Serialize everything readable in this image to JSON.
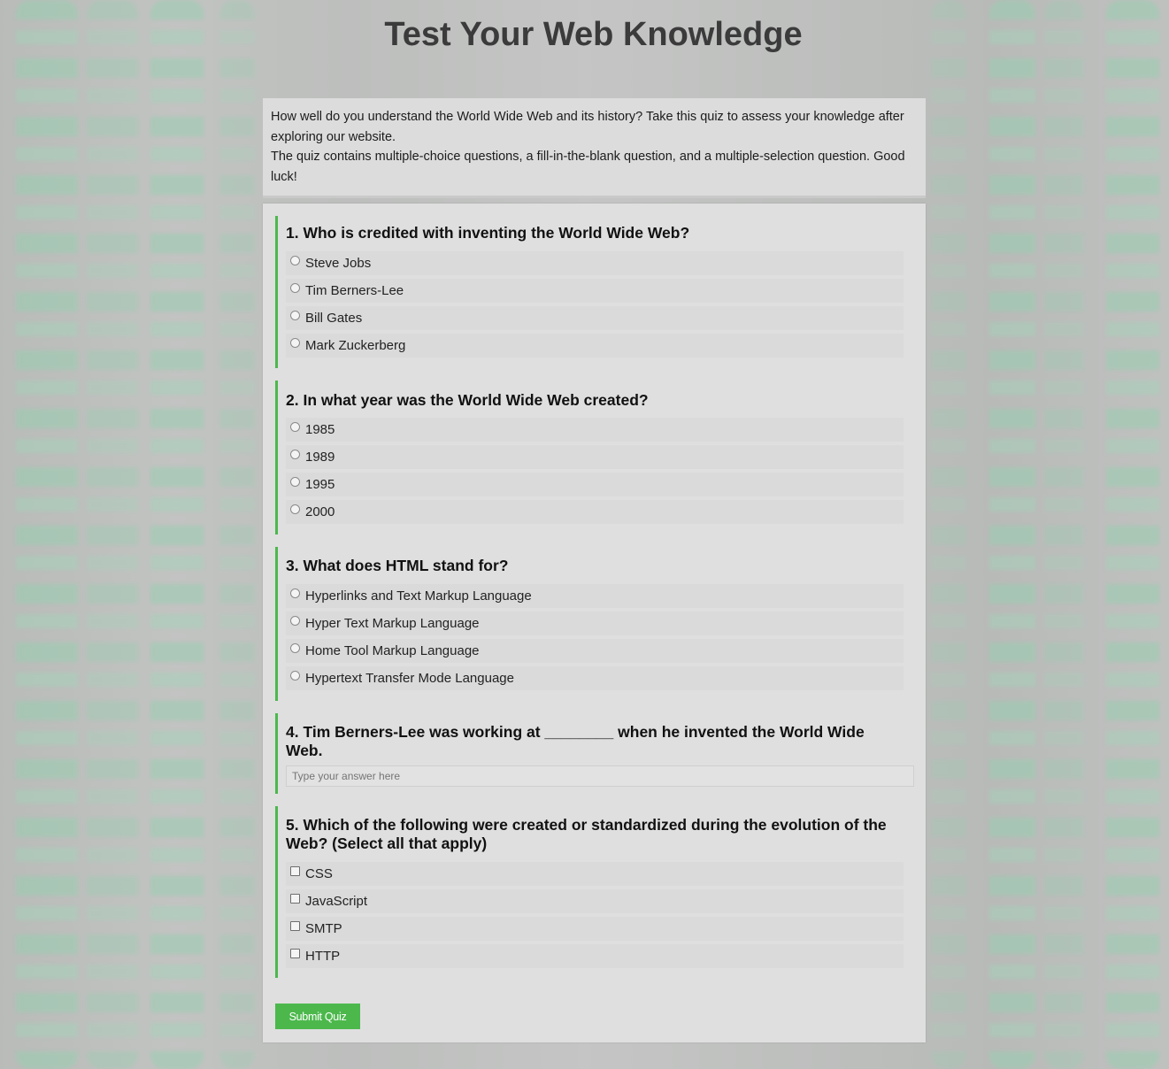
{
  "page": {
    "title": "Test Your Web Knowledge"
  },
  "intro": {
    "line1": "How well do you understand the World Wide Web and its history? Take this quiz to assess your knowledge after exploring our website.",
    "line2": "The quiz contains multiple-choice questions, a fill-in-the-blank question, and a multiple-selection question. Good luck!"
  },
  "questions": [
    {
      "text": "1. Who is credited with inventing the World Wide Web?",
      "type": "radio",
      "options": [
        "Steve Jobs",
        "Tim Berners-Lee",
        "Bill Gates",
        "Mark Zuckerberg"
      ]
    },
    {
      "text": "2. In what year was the World Wide Web created?",
      "type": "radio",
      "options": [
        "1985",
        "1989",
        "1995",
        "2000"
      ]
    },
    {
      "text": "3. What does HTML stand for?",
      "type": "radio",
      "options": [
        "Hyperlinks and Text Markup Language",
        "Hyper Text Markup Language",
        "Home Tool Markup Language",
        "Hypertext Transfer Mode Language"
      ]
    },
    {
      "text": "4. Tim Berners-Lee was working at ________ when he invented the World Wide Web.",
      "type": "text",
      "placeholder": "Type your answer here",
      "value": ""
    },
    {
      "text": "5. Which of the following were created or standardized during the evolution of the Web? (Select all that apply)",
      "type": "checkbox",
      "options": [
        "CSS",
        "JavaScript",
        "SMTP",
        "HTTP"
      ]
    }
  ],
  "submit": {
    "label": "Submit Quiz"
  },
  "colors": {
    "accent": "#4cb84c",
    "heading": "#3b3b3b",
    "panel": "#dfdfdf"
  }
}
